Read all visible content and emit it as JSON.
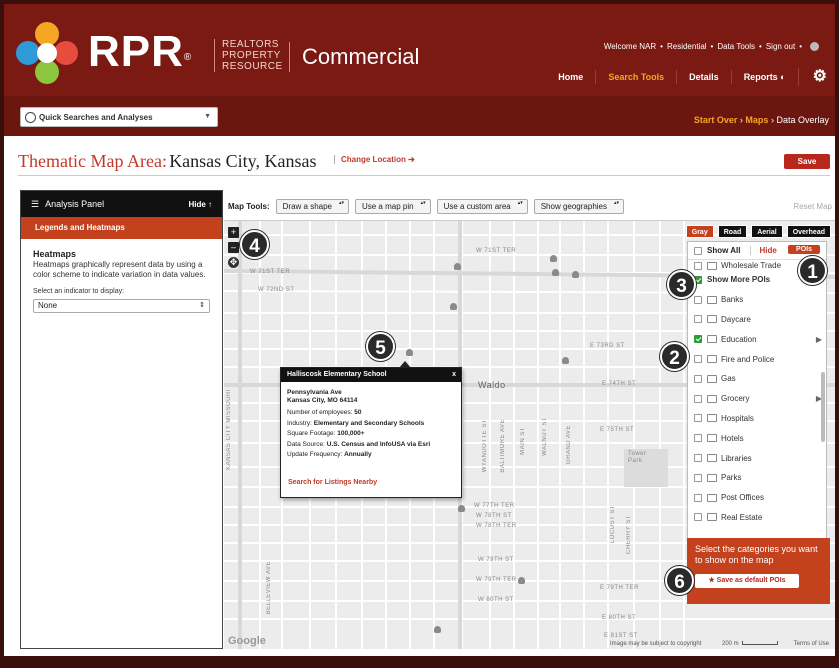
{
  "header": {
    "brand": "RPR",
    "brand_mark": "®",
    "brand_sub": [
      "REALTORS",
      "PROPERTY",
      "RESOURCE"
    ],
    "product": "Commercial",
    "top_links": [
      "Welcome NAR",
      "•",
      "Residential",
      "•",
      "Data Tools",
      "•",
      "Sign out",
      "•"
    ],
    "nav": [
      "Home",
      "Search Tools",
      "Details",
      "Reports"
    ],
    "active_nav": "Search Tools",
    "colors": {
      "header_bg": "#7a1a12",
      "accent": "#c4411e",
      "highlight": "#f5a623"
    }
  },
  "subbar": {
    "quick_search": "Quick Searches and Analyses",
    "breadcrumb": [
      "Start Over",
      "›",
      "Maps",
      "›",
      "Data Overlay"
    ]
  },
  "title": {
    "label": "Thematic Map Area:",
    "value": "Kansas City, Kansas",
    "change": "Change Location ➔",
    "save": "Save"
  },
  "panel": {
    "header": "Analysis Panel",
    "hide": "Hide ↑",
    "tab": "Legends and Heatmaps",
    "heading": "Heatmaps",
    "description": "Heatmaps graphically represent data by using a color scheme to indicate variation in data values.",
    "select_label": "Select an indicator to display:",
    "select_value": "None"
  },
  "map_tools": {
    "label": "Map Tools:",
    "dropdowns": [
      "Draw a shape",
      "Use a map pin",
      "Use a custom area",
      "Show geographies"
    ],
    "reset": "Reset Map"
  },
  "map": {
    "types": [
      "Gray",
      "Road",
      "Aerial",
      "Overhead"
    ],
    "active_type": "Gray",
    "streets_h": [
      {
        "t": "W 71ST TER"
      },
      {
        "t": "W 71ST TER"
      },
      {
        "t": "W 72ND ST"
      },
      {
        "t": "E 73RD ST"
      },
      {
        "t": "E 74TH ST"
      },
      {
        "t": "Waldo"
      },
      {
        "t": "E 75TH ST"
      },
      {
        "t": "W 77TH TER"
      },
      {
        "t": "W 78TH ST"
      },
      {
        "t": "W 78TH TER"
      },
      {
        "t": "W 79TH ST"
      },
      {
        "t": "W 79TH TER"
      },
      {
        "t": "W 80TH ST"
      },
      {
        "t": "E 79TH TER"
      },
      {
        "t": "E 80TH ST"
      },
      {
        "t": "E 81ST ST"
      },
      {
        "t": "Tower Park"
      }
    ],
    "streets_v": [
      {
        "t": "KANSAS CITY MISSOURI"
      },
      {
        "t": "WYANDOTTE ST"
      },
      {
        "t": "BALTIMORE AVE"
      },
      {
        "t": "MAIN ST"
      },
      {
        "t": "WALNUT ST"
      },
      {
        "t": "GRAND AVE"
      },
      {
        "t": "LOCUST ST"
      },
      {
        "t": "CHERRY ST"
      },
      {
        "t": "BELLEVIEW AVE"
      }
    ],
    "footer": {
      "copyright": "Image may be subject to copyright",
      "scale": "200 m",
      "terms": "Terms of Use",
      "google": "Google"
    }
  },
  "poi_panel": {
    "show_all": "Show All",
    "hide": "Hide",
    "tag": "POIs",
    "items": [
      {
        "label": "Wholesale Trade",
        "checked": false,
        "icon": "store-icon"
      },
      {
        "label": "Show More POIs",
        "checked": true,
        "icon": null,
        "bold": true
      },
      {
        "label": "Banks",
        "checked": false,
        "icon": "bank-icon"
      },
      {
        "label": "Daycare",
        "checked": false,
        "icon": "daycare-icon"
      },
      {
        "label": "Education",
        "checked": true,
        "icon": "school-icon",
        "expand": true
      },
      {
        "label": "Fire and Police",
        "checked": false,
        "icon": "fire-police-icon"
      },
      {
        "label": "Gas",
        "checked": false,
        "icon": "gas-icon"
      },
      {
        "label": "Grocery",
        "checked": false,
        "icon": "grocery-icon",
        "expand": true
      },
      {
        "label": "Hospitals",
        "checked": false,
        "icon": "hospital-icon"
      },
      {
        "label": "Hotels",
        "checked": false,
        "icon": "hotel-icon"
      },
      {
        "label": "Libraries",
        "checked": false,
        "icon": "library-icon"
      },
      {
        "label": "Parks",
        "checked": false,
        "icon": "park-icon"
      },
      {
        "label": "Post Offices",
        "checked": false,
        "icon": "mail-icon"
      },
      {
        "label": "Real Estate",
        "checked": false,
        "icon": "real-estate-icon"
      }
    ],
    "footer_text": "Select the categories you want to show on the map",
    "save_default": "★ Save as default POIs"
  },
  "infowindow": {
    "title": "Halliscosk Elementary School",
    "close": "x",
    "address1": "Pennsylvania Ave",
    "address2": "Kansas City, MO 64114",
    "rows": [
      {
        "k": "Number of employees:",
        "v": "50"
      },
      {
        "k": "Industry:",
        "v": "Elementary and Secondary Schools"
      },
      {
        "k": "Square Footage:",
        "v": "100,000+"
      },
      {
        "k": "Data Source:",
        "v": "U.S. Census and InfoUSA via Esri"
      },
      {
        "k": "Update Frequency:",
        "v": "Annually"
      }
    ],
    "link": "Search for Listings Nearby"
  },
  "callouts": [
    "1",
    "2",
    "3",
    "4",
    "5",
    "6"
  ]
}
